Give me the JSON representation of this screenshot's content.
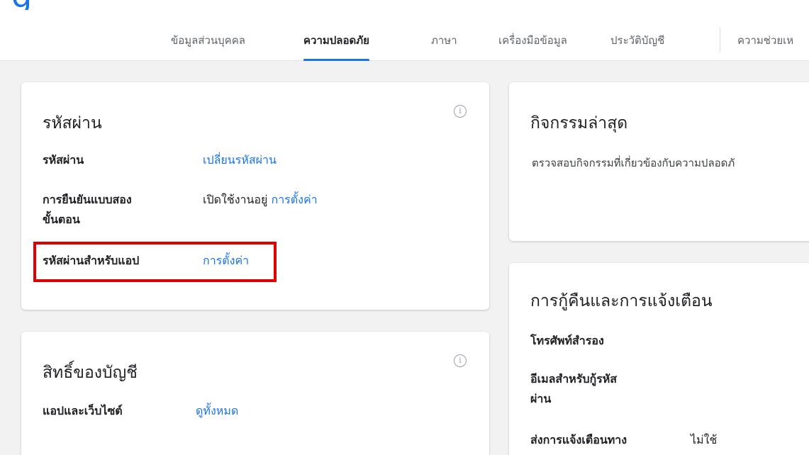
{
  "nav": {
    "items": [
      {
        "label": "ข้อมูลส่วนบุคคล"
      },
      {
        "label": "ความปลอดภัย"
      },
      {
        "label": "ภาษา"
      },
      {
        "label": "เครื่องมือข้อมูล"
      },
      {
        "label": "ประวัติบัญชี"
      },
      {
        "label": "ความช่วยเห"
      }
    ]
  },
  "password_card": {
    "title": "รหัสผ่าน",
    "rows": [
      {
        "label": "รหัสผ่าน",
        "link": "เปลี่ยนรหัสผ่าน"
      },
      {
        "label_line1": "การยืนยันแบบสอง",
        "label_line2": "ขั้นตอน",
        "status": "เปิดใช้งานอยู่",
        "link": "การตั้งค่า"
      },
      {
        "label": "รหัสผ่านสำหรับแอป",
        "link": "การตั้งค่า"
      }
    ]
  },
  "permissions_card": {
    "title": "สิทธิ์ของบัญชี",
    "rows": [
      {
        "label": "แอปและเว็บไซต์",
        "link": "ดูทั้งหมด"
      }
    ]
  },
  "activity_card": {
    "title": "กิจกรรมล่าสุด",
    "description": "ตรวจสอบกิจกรรมที่เกี่ยวข้องกับความปลอดภั"
  },
  "recovery_card": {
    "title": "การกู้คืนและการแจ้งเตือน",
    "rows": [
      {
        "label": "โทรศัพท์สำรอง"
      },
      {
        "label_line1": "อีเมลสำหรับกู้รหัส",
        "label_line2": "ผ่าน"
      },
      {
        "label": "ส่งการแจ้งเตือนทาง",
        "value": "ไม่ใช้"
      }
    ]
  },
  "colors": {
    "accent": "#1a73e8",
    "highlight": "#e00000"
  }
}
